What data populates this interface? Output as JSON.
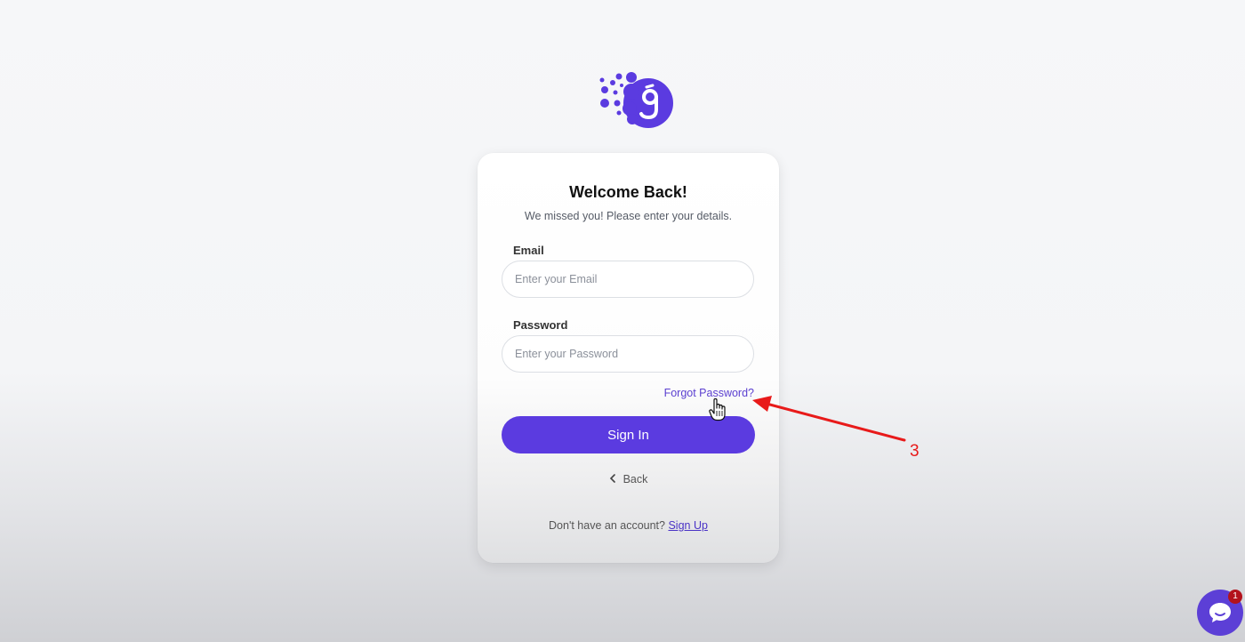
{
  "card": {
    "title": "Welcome Back!",
    "subtitle": "We missed you! Please enter your details.",
    "email": {
      "label": "Email",
      "value": "",
      "placeholder": "Enter your Email"
    },
    "password": {
      "label": "Password",
      "value": "",
      "placeholder": "Enter your Password"
    },
    "forgot_password": "Forgot Password?",
    "signin_label": "Sign In",
    "back_label": "Back",
    "back_icon": "chevron-left-icon",
    "signup_prompt": "Don't have an account?",
    "signup_link": "Sign Up"
  },
  "brand": {
    "logo_icon": "brand-logo-icon",
    "accent_color": "#5b3be0"
  },
  "annotation": {
    "label": "3",
    "color": "#e81a1a",
    "icon": "red-arrow-icon"
  },
  "cursor": {
    "icon": "hand-pointer-icon"
  },
  "chat_widget": {
    "icon": "chat-bubble-icon",
    "badge_count": "1",
    "badge_color": "#b3121c"
  }
}
